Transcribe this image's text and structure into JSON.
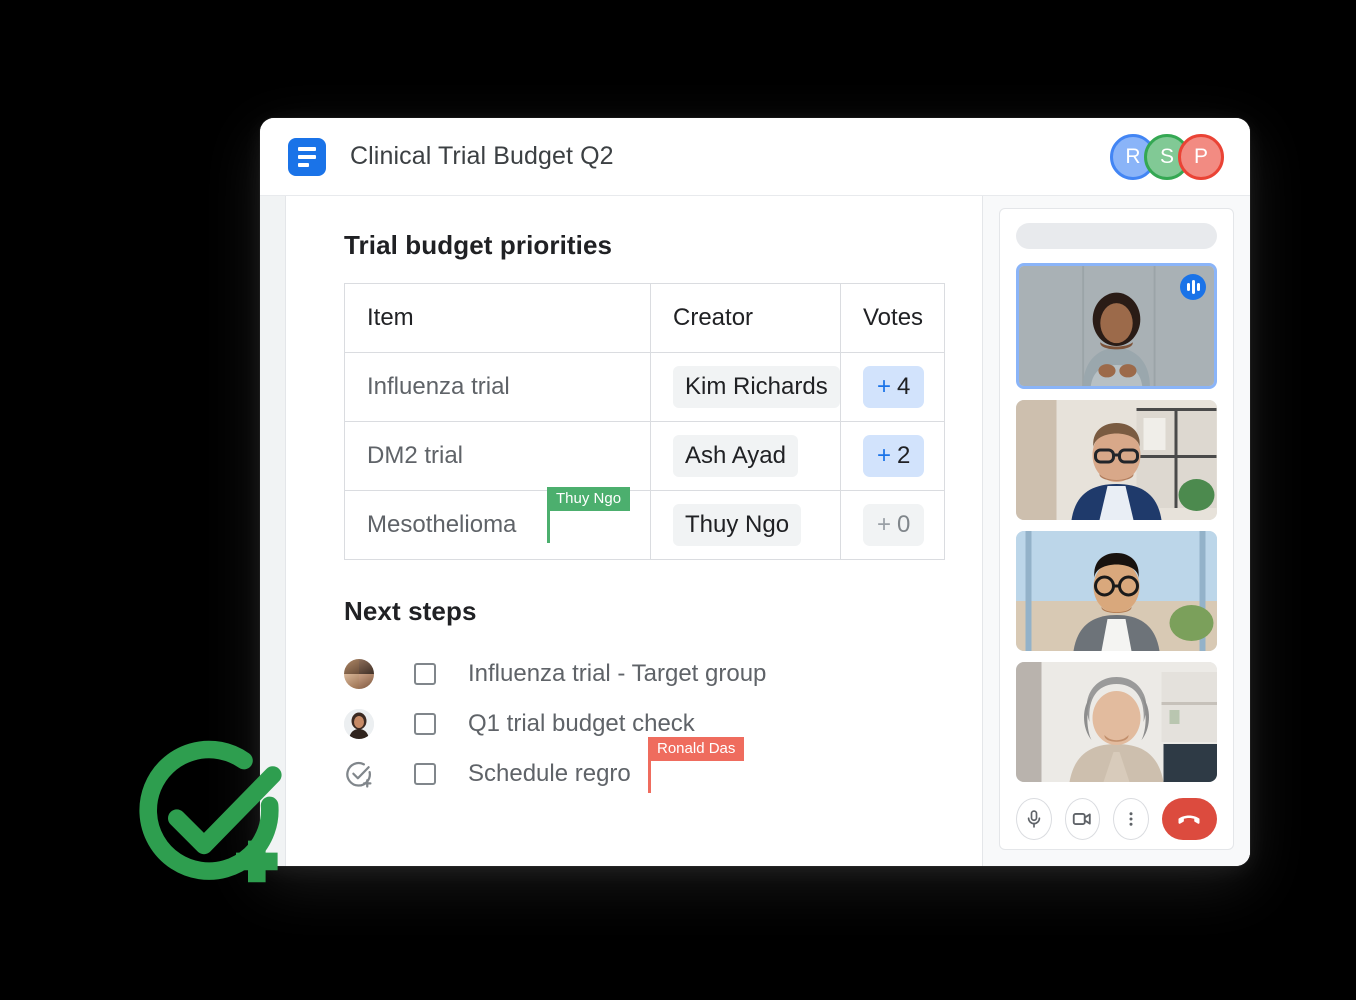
{
  "window": {
    "titlebar": {
      "app_icon": "docs-icon",
      "document_title": "Clinical Trial Budget Q2",
      "collaborator_avatars": [
        {
          "initial": "R",
          "ring_color": "#4285f4",
          "fill_color": "#8ab4f8"
        },
        {
          "initial": "S",
          "ring_color": "#34a853",
          "fill_color": "#81c995"
        },
        {
          "initial": "P",
          "ring_color": "#ea4335",
          "fill_color": "#f28b82"
        }
      ]
    }
  },
  "document": {
    "heading": "Trial budget priorities",
    "table": {
      "columns": [
        "Item",
        "Creator",
        "Votes"
      ],
      "rows": [
        {
          "item": "Influenza trial",
          "creator": "Kim Richards",
          "vote_plus": "+",
          "vote_count": "4",
          "voted": true
        },
        {
          "item": "DM2 trial",
          "creator": "Ash Ayad",
          "vote_plus": "+",
          "vote_count": "2",
          "voted": true
        },
        {
          "item": "Mesothelioma",
          "creator": "Thuy Ngo",
          "vote_plus": "+",
          "vote_count": "0",
          "voted": false
        }
      ]
    },
    "cursors": {
      "thuy": {
        "label": "Thuy Ngo",
        "color": "#4caf6e"
      },
      "ronald": {
        "label": "Ronald Das",
        "color": "#ef6c5e"
      }
    },
    "next_steps": {
      "heading": "Next steps",
      "tasks": [
        {
          "text": "Influenza trial - Target group",
          "avatar": "group-avatar",
          "checked": false
        },
        {
          "text": "Q1 trial budget check",
          "avatar": "single-avatar",
          "checked": false
        },
        {
          "text": "Schedule regro",
          "avatar": "assign-task-icon",
          "checked": false
        }
      ]
    }
  },
  "call_panel": {
    "participants": [
      {
        "name": "participant-1",
        "speaking": true
      },
      {
        "name": "participant-2",
        "speaking": false
      },
      {
        "name": "participant-3",
        "speaking": false
      },
      {
        "name": "participant-4",
        "speaking": false
      }
    ],
    "controls": [
      {
        "name": "microphone-button",
        "icon": "microphone-icon"
      },
      {
        "name": "camera-button",
        "icon": "video-camera-icon"
      },
      {
        "name": "more-options-button",
        "icon": "three-dots-icon"
      },
      {
        "name": "end-call-button",
        "icon": "phone-hangup-icon",
        "color": "#dc4b3e"
      }
    ]
  },
  "logo": {
    "name": "tasks-check-plus-logo",
    "color": "#2e9e4f"
  }
}
